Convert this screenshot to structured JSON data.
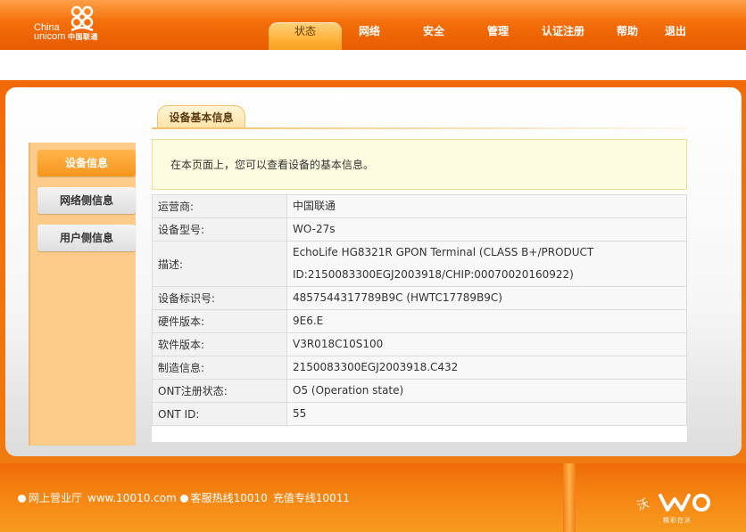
{
  "brand": {
    "logo_en": "China\nunicom",
    "logo_cn": "中国联通"
  },
  "nav": {
    "items": [
      {
        "label": "状态",
        "active": true
      },
      {
        "label": "网络"
      },
      {
        "label": "安全"
      },
      {
        "label": "管理"
      },
      {
        "label": "认证注册"
      },
      {
        "label": "帮助"
      },
      {
        "label": "退出"
      }
    ]
  },
  "breadcrumb": "设备基本信息",
  "sidebar": {
    "items": [
      {
        "label": "设备信息",
        "active": true
      },
      {
        "label": "网络侧信息"
      },
      {
        "label": "用户侧信息"
      }
    ]
  },
  "intro_text": "在本页面上，您可以查看设备的基本信息。",
  "info_rows": [
    {
      "label": "运营商:",
      "value": "中国联通"
    },
    {
      "label": "设备型号:",
      "value": "WO-27s"
    },
    {
      "label": "描述:",
      "value": "EchoLife HG8321R GPON Terminal (CLASS B+/PRODUCT ID:2150083300EGJ2003918/CHIP:00070020160922)"
    },
    {
      "label": "设备标识号:",
      "value": "4857544317789B9C (HWTC17789B9C)"
    },
    {
      "label": "硬件版本:",
      "value": "9E6.E"
    },
    {
      "label": "软件版本:",
      "value": "V3R018C10S100"
    },
    {
      "label": "制造信息:",
      "value": "2150083300EGJ2003918.C432"
    },
    {
      "label": "ONT注册状态:",
      "value": "O5 (Operation state)"
    },
    {
      "label": "ONT ID:",
      "value": "55"
    }
  ],
  "footer": {
    "link1": "网上营业厅",
    "url": "www.10010.com",
    "hotline": "客服热线10010",
    "recharge": "充值专线10011",
    "wo_tag": "精彩在沃"
  },
  "colors": {
    "brand_orange": "#f26a07",
    "sidebar_bg": "#fccb8a",
    "intro_bg": "#fdfbe0"
  }
}
